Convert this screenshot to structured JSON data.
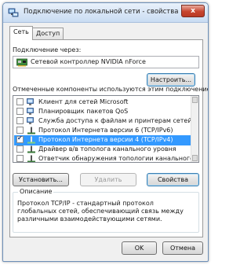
{
  "window": {
    "title": "Подключение по локальной сети - свойства",
    "close_glyph": "x"
  },
  "tabs": [
    {
      "label": "Сеть"
    },
    {
      "label": "Доступ"
    }
  ],
  "connect_using": {
    "label": "Подключение через:",
    "adapter": "Сетевой контроллер NVIDIA nForce",
    "configure_button": "Настроить..."
  },
  "components": {
    "label": "Отмеченные компоненты используются этим подключением:",
    "items": [
      {
        "label": "Клиент для сетей Microsoft",
        "checked": false,
        "selected": false,
        "icon": "network-client-icon"
      },
      {
        "label": "Планировщик пакетов QoS",
        "checked": false,
        "selected": false,
        "icon": "qos-scheduler-icon"
      },
      {
        "label": "Служба доступа к файлам и принтерам сетей Micro",
        "checked": false,
        "selected": false,
        "icon": "file-printer-sharing-icon"
      },
      {
        "label": "Протокол Интернета версии 6 (TCP/IPv6)",
        "checked": false,
        "selected": false,
        "icon": "protocol-icon"
      },
      {
        "label": "Протокол Интернета версии 4 (TCP/IPv4)",
        "checked": true,
        "selected": true,
        "icon": "protocol-icon"
      },
      {
        "label": "Драйвер в/в тополога канального уровня",
        "checked": false,
        "selected": false,
        "icon": "protocol-icon"
      },
      {
        "label": "Ответчик обнаружения топологии канального уровня",
        "checked": false,
        "selected": false,
        "icon": "protocol-icon"
      }
    ]
  },
  "buttons": {
    "install": "Установить...",
    "remove": "Удалить",
    "properties": "Свойства"
  },
  "description": {
    "title": "Описание",
    "text": "Протокол TCP/IP - стандартный протокол глобальных сетей, обеспечивающий связь между различными взаимодействующими сетями."
  },
  "footer": {
    "ok": "OK",
    "cancel": "Отмена"
  },
  "colors": {
    "selection": "#3399ff",
    "titlebar": "#c9dcf2",
    "close": "#c7452f"
  }
}
